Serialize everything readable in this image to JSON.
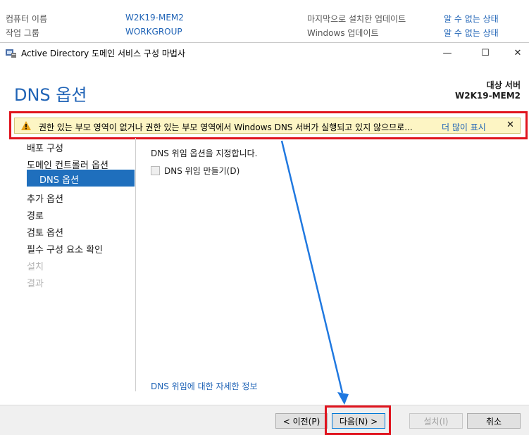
{
  "background_props": {
    "computer_name_label": "컴퓨터 이름",
    "computer_name_value": "W2K19-MEM2",
    "workgroup_label": "작업 그룹",
    "workgroup_value": "WORKGROUP",
    "last_update_label": "마지막으로 설치한 업데이트",
    "last_update_value": "알 수 없는 상태",
    "windows_update_label": "Windows 업데이트",
    "windows_update_value": "알 수 없는 상태"
  },
  "window": {
    "title": "Active Directory 도메인 서비스 구성 마법사",
    "minimize": "—",
    "maximize": "☐",
    "close": "✕"
  },
  "header": {
    "page_title": "DNS 옵션",
    "target_label": "대상 서버",
    "target_name": "W2K19-MEM2"
  },
  "warning": {
    "text": "권한 있는 부모 영역이 없거나 권한 있는 부모 영역에서 Windows DNS 서버가 실행되고 있지 않으므로...",
    "more_link": "더 많이 표시",
    "close": "✕"
  },
  "nav": {
    "items": [
      {
        "label": "배포 구성"
      },
      {
        "label": "도메인 컨트롤러 옵션"
      },
      {
        "label": "DNS 옵션"
      },
      {
        "label": "추가 옵션"
      },
      {
        "label": "경로"
      },
      {
        "label": "검토 옵션"
      },
      {
        "label": "필수 구성 요소 확인"
      },
      {
        "label": "설치"
      },
      {
        "label": "결과"
      }
    ]
  },
  "content": {
    "description": "DNS 위임 옵션을 지정합니다.",
    "checkbox_label": "DNS 위임 만들기(D)",
    "more_info_link": "DNS 위임에 대한 자세한 정보"
  },
  "footer": {
    "prev_label": "< 이전(P)",
    "next_label": "다음(N) >",
    "install_label": "설치(I)",
    "cancel_label": "취소"
  },
  "colors": {
    "accent": "#1f63b6",
    "highlight_red": "#e0141e",
    "nav_selected": "#1f6fbd",
    "warning_bg": "#fdf5c4"
  }
}
